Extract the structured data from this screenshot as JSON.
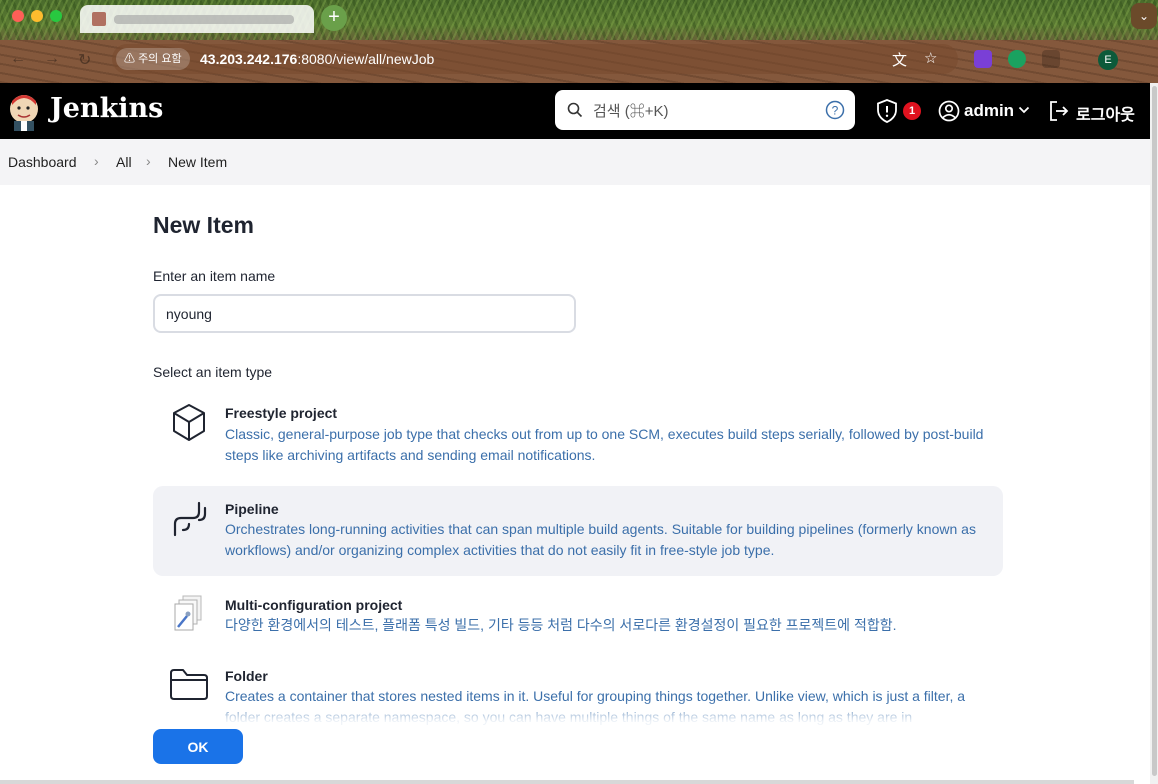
{
  "browser": {
    "security_label": "주의 요함",
    "url_host": "43.203.242.176",
    "url_rest": ":8080/view/all/newJob",
    "new_tab_symbol": "+",
    "profile_initial": "E",
    "profile_arrow": "⌄"
  },
  "header": {
    "brand": "Jenkins",
    "search_placeholder": "검색 (⌘+K)",
    "notification_count": "1",
    "user_name": "admin",
    "logout_label": "로그아웃"
  },
  "breadcrumb": {
    "items": [
      "Dashboard",
      "All",
      "New Item"
    ]
  },
  "main": {
    "title": "New Item",
    "name_label": "Enter an item name",
    "name_value": "nyoung",
    "type_label": "Select an item type",
    "item_types": [
      {
        "title": "Freestyle project",
        "description": "Classic, general-purpose job type that checks out from up to one SCM, executes build steps serially, followed by post-build steps like archiving artifacts and sending email notifications.",
        "icon": "freestyle-icon"
      },
      {
        "title": "Pipeline",
        "description": "Orchestrates long-running activities that can span multiple build agents. Suitable for building pipelines (formerly known as workflows) and/or organizing complex activities that do not easily fit in free-style job type.",
        "icon": "pipeline-icon",
        "selected": true
      },
      {
        "title": "Multi-configuration project",
        "description": "다양한 환경에서의 테스트, 플래폼 특성 빌드, 기타 등등 처럼 다수의 서로다른 환경설정이 필요한 프로젝트에 적합함.",
        "icon": "multiconfig-icon"
      },
      {
        "title": "Folder",
        "description": "Creates a container that stores nested items in it. Useful for grouping things together. Unlike view, which is just a filter, a folder creates a separate namespace, so you can have multiple things of the same name as long as they are in",
        "icon": "folder-icon"
      }
    ],
    "ok_label": "OK"
  },
  "colors": {
    "accent": "#1a73e8",
    "link_text": "#3b6faa",
    "header_bg": "#000000",
    "badge": "#e0121f"
  }
}
